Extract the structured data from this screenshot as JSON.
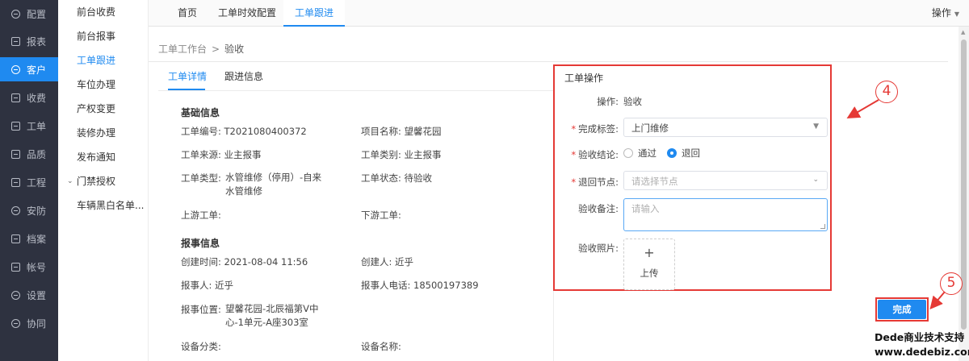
{
  "sidebar": {
    "items": [
      {
        "label": "配置",
        "icon": "gear-icon",
        "active": false
      },
      {
        "label": "报表",
        "icon": "report-icon",
        "active": false
      },
      {
        "label": "客户",
        "icon": "user-icon",
        "active": true
      },
      {
        "label": "收费",
        "icon": "wallet-icon",
        "active": false
      },
      {
        "label": "工单",
        "icon": "clipboard-icon",
        "active": false
      },
      {
        "label": "品质",
        "icon": "quality-icon",
        "active": false
      },
      {
        "label": "工程",
        "icon": "wrench-icon",
        "active": false
      },
      {
        "label": "安防",
        "icon": "shield-icon",
        "active": false
      },
      {
        "label": "档案",
        "icon": "archive-icon",
        "active": false
      },
      {
        "label": "帐号",
        "icon": "account-icon",
        "active": false
      },
      {
        "label": "设置",
        "icon": "settings-icon",
        "active": false
      },
      {
        "label": "协同",
        "icon": "team-icon",
        "active": false
      }
    ]
  },
  "submenu": {
    "items": [
      {
        "label": "前台收费"
      },
      {
        "label": "前台报事"
      },
      {
        "label": "工单跟进"
      },
      {
        "label": "车位办理"
      },
      {
        "label": "产权变更"
      },
      {
        "label": "装修办理"
      },
      {
        "label": "发布通知"
      },
      {
        "label": "门禁授权"
      },
      {
        "label": "车辆黑白名单..."
      }
    ]
  },
  "tabs": [
    {
      "label": "首页"
    },
    {
      "label": "工单时效配置"
    },
    {
      "label": "工单跟进"
    }
  ],
  "header": {
    "ops_label": "操作"
  },
  "breadcrumb": {
    "parent": "工单工作台",
    "sep": ">",
    "current": "验收"
  },
  "detail_tabs": [
    {
      "label": "工单详情"
    },
    {
      "label": "跟进信息"
    }
  ],
  "basic": {
    "title": "基础信息",
    "order_no_label": "工单编号:",
    "order_no": "T2021080400372",
    "project_label": "项目名称:",
    "project": "望馨花园",
    "source_label": "工单来源:",
    "source": "业主报事",
    "category_label": "工单类别:",
    "category": "业主报事",
    "type_label": "工单类型:",
    "type_line1": "水管维修（停用）-自来",
    "type_line2": "水管维修",
    "status_label": "工单状态:",
    "status": "待验收",
    "upstream_label": "上游工单:",
    "downstream_label": "下游工单:"
  },
  "report": {
    "title": "报事信息",
    "created_label": "创建时间:",
    "created": "2021-08-04 11:56",
    "creator_label": "创建人:",
    "creator": "近乎",
    "reporter_label": "报事人:",
    "reporter": "近乎",
    "phone_label": "报事人电话:",
    "phone": "18500197389",
    "location_label": "报事位置:",
    "location_line1": "望馨花园-北辰福第V中",
    "location_line2": "心-1单元-A座303室",
    "device_cat_label": "设备分类:",
    "device_name_label": "设备名称:"
  },
  "operation": {
    "title": "工单操作",
    "op_label": "操作:",
    "op_value": "验收",
    "tag_label": "完成标签:",
    "tag_value": "上门维修",
    "result_label": "验收结论:",
    "opt_pass": "通过",
    "opt_return": "退回",
    "node_label": "退回节点:",
    "node_placeholder": "请选择节点",
    "remark_label": "验收备注:",
    "remark_placeholder": "请输入",
    "photo_label": "验收照片:",
    "upload_label": "上传"
  },
  "annotations": {
    "step4": "4",
    "step5": "5",
    "color": "#e53935"
  },
  "done_button": "完成",
  "watermark": {
    "line1": "Dede商业技术支持",
    "line2": "www.dedebiz.com"
  },
  "colors": {
    "accent": "#1f8af0",
    "sidebar": "#2e3240",
    "highlight": "#e53935"
  }
}
